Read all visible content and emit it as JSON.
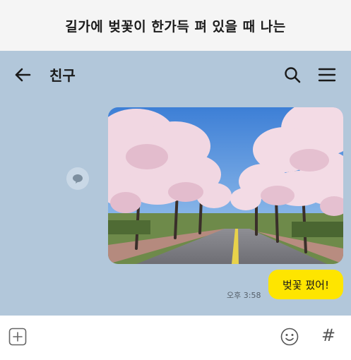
{
  "caption": "길가에 벚꽃이 한가득 펴 있을 때 나는",
  "header": {
    "title": "친구",
    "back_icon": "arrow-left-icon",
    "search_icon": "search-icon",
    "menu_icon": "hamburger-menu-icon"
  },
  "messages": {
    "photo_alt": "cherry-blossom-road-photo",
    "text": "벚꽃 폈어!",
    "time": "오후 3:58"
  },
  "input_bar": {
    "plus_icon": "plus-square-icon",
    "emoji_icon": "emoji-icon",
    "hash_label": "#"
  },
  "colors": {
    "chat_bg": "#b2c7da",
    "bubble": "#fee500",
    "caption_bg": "#f5f5f5"
  }
}
